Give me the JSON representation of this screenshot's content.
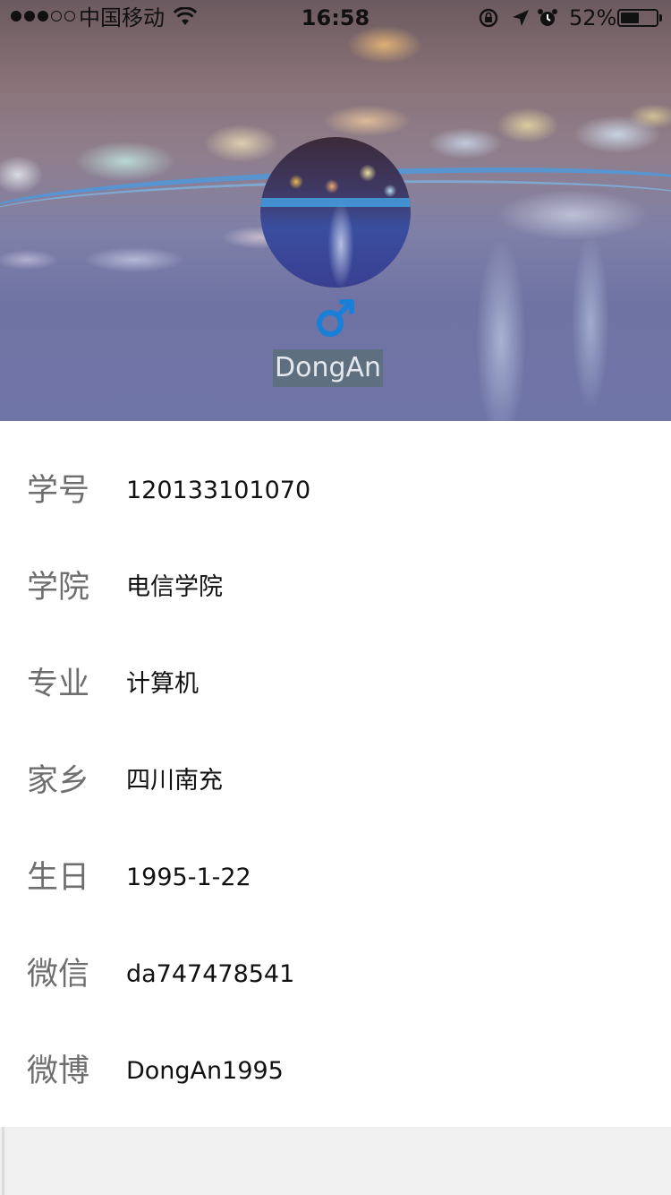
{
  "status_bar": {
    "carrier": "中国移动",
    "time": "16:58",
    "battery_percent_label": "52%",
    "battery_level": 0.52,
    "signal_filled": 3,
    "signal_total": 5,
    "icons": [
      "signal-icon",
      "wifi-icon",
      "rotation-lock-icon",
      "location-arrow-icon",
      "alarm-clock-icon",
      "battery-icon"
    ]
  },
  "profile": {
    "name": "DongAn",
    "gender_symbol": "♂",
    "gender_color": "#1a7fd6"
  },
  "info": [
    {
      "label": "学号",
      "value": "120133101070"
    },
    {
      "label": "学院",
      "value": "电信学院"
    },
    {
      "label": "专业",
      "value": "计算机"
    },
    {
      "label": "家乡",
      "value": "四川南充"
    },
    {
      "label": "生日",
      "value": "1995-1-22"
    },
    {
      "label": "微信",
      "value": "da747478541"
    },
    {
      "label": "微博",
      "value": "DongAn1995"
    }
  ],
  "colors": {
    "label": "#6e6e6e",
    "value": "#111111",
    "background": "#f0f0f0",
    "list_background": "#ffffff",
    "name_background": "#5a6e78"
  }
}
